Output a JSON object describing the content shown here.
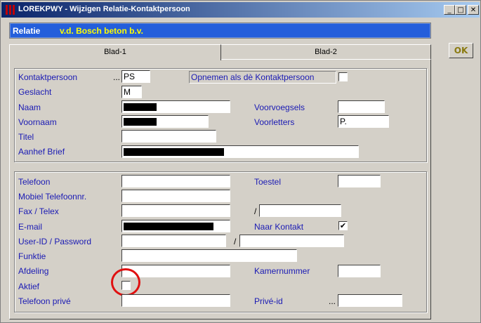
{
  "window": {
    "title": "LOREKPWY - Wijzigen Relatie-Kontaktpersoon",
    "minimize_glyph": "_",
    "maximize_glyph": "□",
    "close_glyph": "✕"
  },
  "relatie": {
    "label": "Relatie",
    "value": "v.d. Bosch beton b.v."
  },
  "ok_button": {
    "label": "OK"
  },
  "tabs": [
    {
      "label": "Blad-1",
      "active": true
    },
    {
      "label": "Blad-2",
      "active": false
    }
  ],
  "section1": {
    "kontaktpersoon": {
      "label": "Kontaktpersoon",
      "ellipsis": "...",
      "value": "PS"
    },
    "opnemen": {
      "label": "Opnemen als dè Kontaktpersoon",
      "checked": false
    },
    "geslacht": {
      "label": "Geslacht",
      "value": "M"
    },
    "naam": {
      "label": "Naam",
      "value": "",
      "redacted": true
    },
    "voorvoegsels": {
      "label": "Voorvoegsels",
      "value": ""
    },
    "voornaam": {
      "label": "Voornaam",
      "value": "",
      "redacted": true
    },
    "voorletters": {
      "label": "Voorletters",
      "value": "P."
    },
    "titel": {
      "label": "Titel",
      "value": ""
    },
    "aanhef": {
      "label": "Aanhef Brief",
      "value": "",
      "redacted": true
    }
  },
  "section2": {
    "telefoon": {
      "label": "Telefoon",
      "value": ""
    },
    "toestel": {
      "label": "Toestel",
      "value": ""
    },
    "mobiel": {
      "label": "Mobiel Telefoonnr.",
      "value": ""
    },
    "fax": {
      "label": "Fax / Telex",
      "value": ""
    },
    "fax_extra": {
      "separator": "/",
      "value": ""
    },
    "email": {
      "label": "E-mail",
      "value": "",
      "redacted": true
    },
    "naar_kontakt": {
      "label": "Naar Kontakt",
      "checked": true,
      "check_glyph": "✔"
    },
    "userid": {
      "label": "User-ID / Password",
      "value": ""
    },
    "password": {
      "separator": "/",
      "value": ""
    },
    "funktie": {
      "label": "Funktie",
      "value": ""
    },
    "afdeling": {
      "label": "Afdeling",
      "value": ""
    },
    "kamernummer": {
      "label": "Kamernummer",
      "value": ""
    },
    "aktief": {
      "label": "Aktief",
      "checked": false
    },
    "telefoon_prive": {
      "label": "Telefoon privé",
      "value": ""
    },
    "prive_id": {
      "label": "Privé-id",
      "ellipsis": "...",
      "value": ""
    }
  },
  "colors": {
    "title_start": "#0a246a",
    "relatie_bar": "#245edb",
    "relatie_value": "#ffff00",
    "label_text": "#1a1ab4",
    "highlight_circle": "#e01010"
  }
}
